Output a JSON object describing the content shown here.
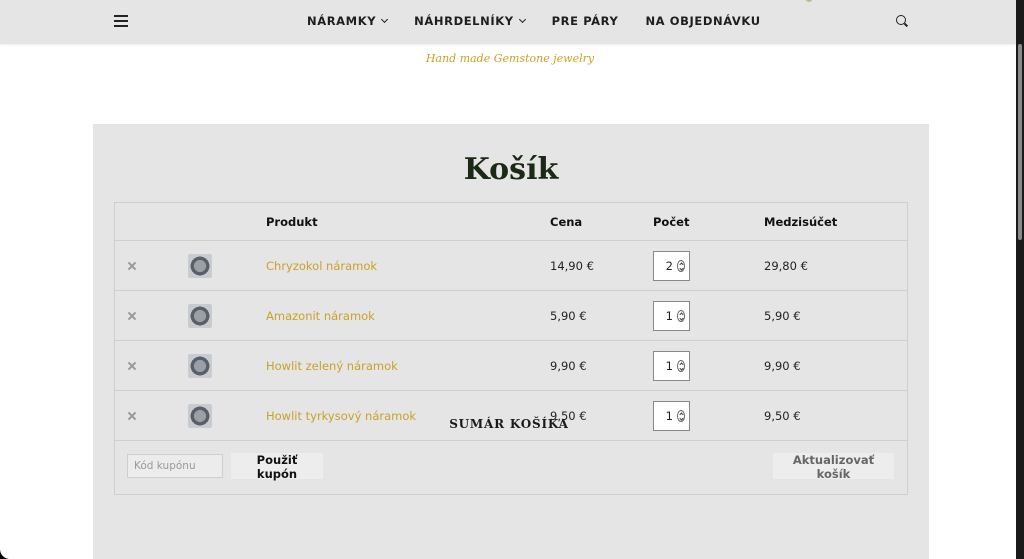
{
  "nav": {
    "items": [
      {
        "label": "NÁRAMKY",
        "dropdown": true
      },
      {
        "label": "NÁHRDELNÍKY",
        "dropdown": true
      },
      {
        "label": "PRE PÁRY",
        "dropdown": false
      },
      {
        "label": "NA OBJEDNÁVKU",
        "dropdown": false
      }
    ],
    "menu_icon": "hamburger-menu-icon",
    "search_icon": "search-icon"
  },
  "tagline": "Hand made Gemstone jewelry",
  "cart": {
    "title": "Košík",
    "headers": {
      "product": "Produkt",
      "price": "Cena",
      "quantity": "Počet",
      "subtotal": "Medzisúčet"
    },
    "items": [
      {
        "name": "Chryzokol náramok",
        "price": "14,90 €",
        "quantity": "2",
        "subtotal": "29,80 €"
      },
      {
        "name": "Amazonit náramok",
        "price": "5,90 €",
        "quantity": "1",
        "subtotal": "5,90 €"
      },
      {
        "name": "Howlit zelený náramok",
        "price": "9,90 €",
        "quantity": "1",
        "subtotal": "9,90 €"
      },
      {
        "name": "Howlit tyrkysový náramok",
        "price": "9,50 €",
        "quantity": "1",
        "subtotal": "9,50 €"
      }
    ],
    "coupon_placeholder": "Kód kupónu",
    "apply_coupon_label": "Použiť kupón",
    "update_cart_label": "Aktualizovať košík"
  },
  "summary_title": "SUMÁR KOŠÍKA",
  "colors": {
    "accent": "#c9a227",
    "title": "#1a2a16",
    "card_bg": "#e5e5e5",
    "nav_bg": "#e5e5e5"
  }
}
